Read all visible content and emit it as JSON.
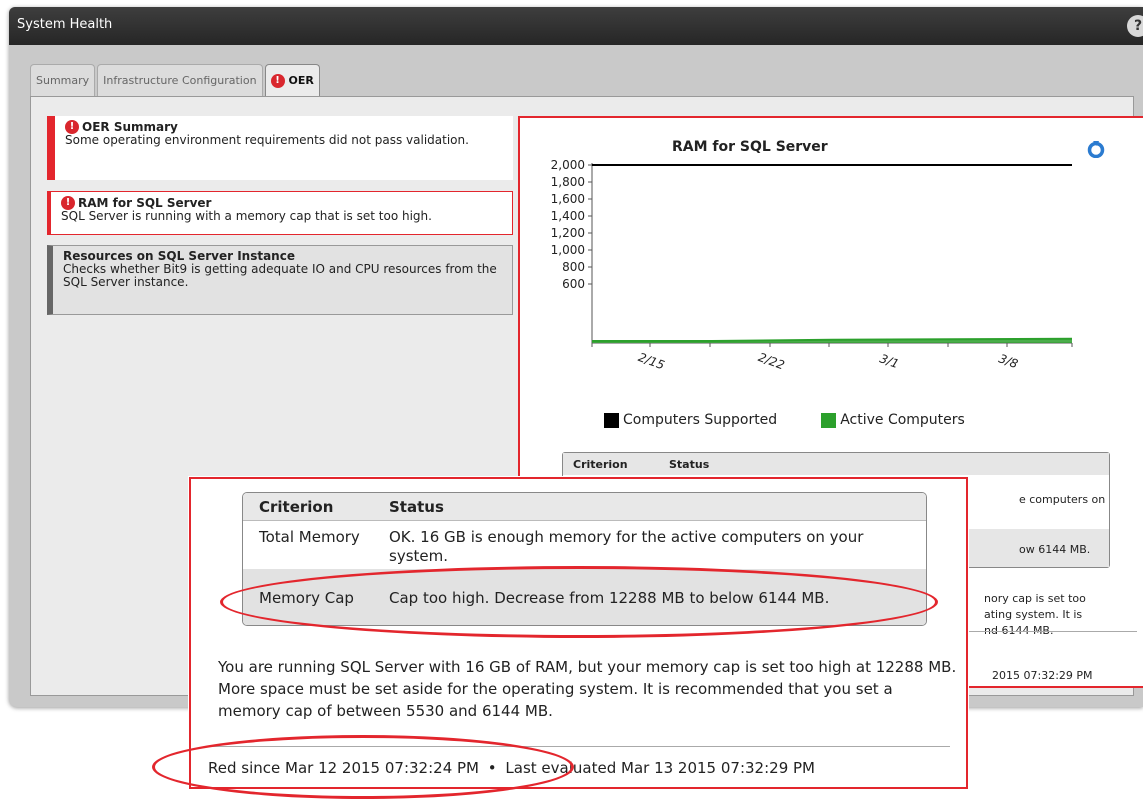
{
  "window": {
    "title": "System Health",
    "help_label": "?"
  },
  "tabs": [
    {
      "label": "Summary",
      "active": false
    },
    {
      "label": "Infrastructure Configuration",
      "active": false
    },
    {
      "label": "OER",
      "active": true,
      "alert": true
    }
  ],
  "sidebar": {
    "items": [
      {
        "title": "OER Summary",
        "description": "Some operating environment requirements did not pass validation.",
        "status": "error"
      },
      {
        "title": "RAM for SQL Server",
        "description": "SQL Server is running with a memory cap that is set too high.",
        "status": "error"
      },
      {
        "title": "Resources on SQL Server Instance",
        "description": "Checks whether Bit9 is getting adequate IO and CPU resources from the SQL Server instance.",
        "status": "neutral"
      }
    ]
  },
  "alert_glyph": "!",
  "chart_data": {
    "type": "line",
    "title": "RAM for SQL Server",
    "x": [
      "2/15",
      "2/22",
      "3/1",
      "3/8"
    ],
    "ylim": [
      0,
      2000
    ],
    "yticks": [
      "2,000",
      "1,800",
      "1,600",
      "1,400",
      "1,200",
      "1,000",
      "800",
      "600"
    ],
    "series": [
      {
        "name": "Computers Supported",
        "values": [
          2000,
          2000,
          2000,
          2000,
          2000
        ],
        "color": "#000000"
      },
      {
        "name": "Active Computers",
        "values": [
          0,
          20,
          40,
          45,
          50
        ],
        "color": "#2ca02c"
      }
    ],
    "legend_position": "bottom"
  },
  "panel_table": {
    "headers": [
      "Criterion",
      "Status"
    ],
    "visible_fragments": [
      "e computers on",
      "ow 6144 MB.",
      "nory cap is set too",
      "ating system. It is",
      "nd 6144 MB.",
      "2015 07:32:29 PM"
    ]
  },
  "callout": {
    "headers": {
      "criterion": "Criterion",
      "status": "Status"
    },
    "rows": [
      {
        "criterion": "Total Memory",
        "status": "OK. 16 GB is enough memory for the active computers on your system."
      },
      {
        "criterion": "Memory Cap",
        "status": "Cap too high. Decrease from 12288 MB  to below 6144 MB."
      }
    ],
    "description": "You are running SQL Server with 16 GB of RAM, but your memory cap is set too high at 12288 MB. More space must be set aside for the operating system. It is recommended that you set a memory cap of between 5530 and 6144 MB.",
    "red_since": "Red since Mar 12 2015 07:32:24 PM",
    "separator": "•",
    "last_evaluated": "Last evaluated Mar 13 2015 07:32:29 PM"
  },
  "colors": {
    "alert_red": "#e3262d",
    "computers_supported": "#000000",
    "active_computers": "#2ca02c",
    "titlebar": "#2e2e2e"
  }
}
